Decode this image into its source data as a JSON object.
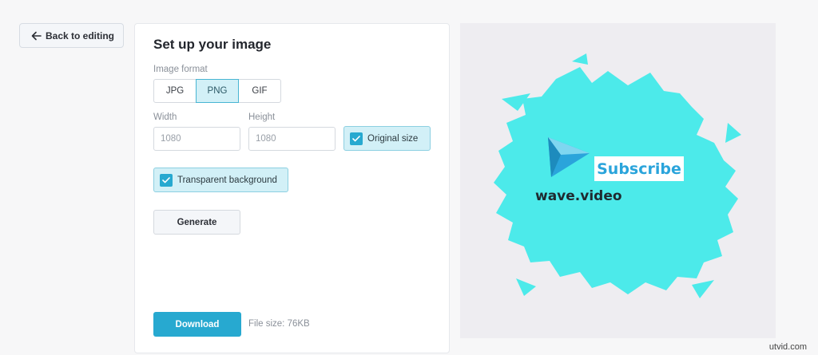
{
  "back_button": {
    "label": "Back to editing",
    "icon": "arrow-left-icon"
  },
  "panel": {
    "title": "Set up your image",
    "format": {
      "label": "Image format",
      "options": [
        "JPG",
        "PNG",
        "GIF"
      ],
      "selected": "PNG"
    },
    "width": {
      "label": "Width",
      "placeholder": "1080"
    },
    "height": {
      "label": "Height",
      "placeholder": "1080"
    },
    "original_size": {
      "label": "Original size",
      "checked": true
    },
    "transparent_background": {
      "label": "Transparent background",
      "checked": true
    },
    "generate_label": "Generate",
    "download_label": "Download",
    "file_size": "File size: 76KB"
  },
  "preview": {
    "brand": "wave.video",
    "subscribe": "Subscribe",
    "colors": {
      "brush": "#4ceaea",
      "logo": "#2aa4db",
      "background": "#eeedf1"
    }
  },
  "watermark": "utvid.com"
}
